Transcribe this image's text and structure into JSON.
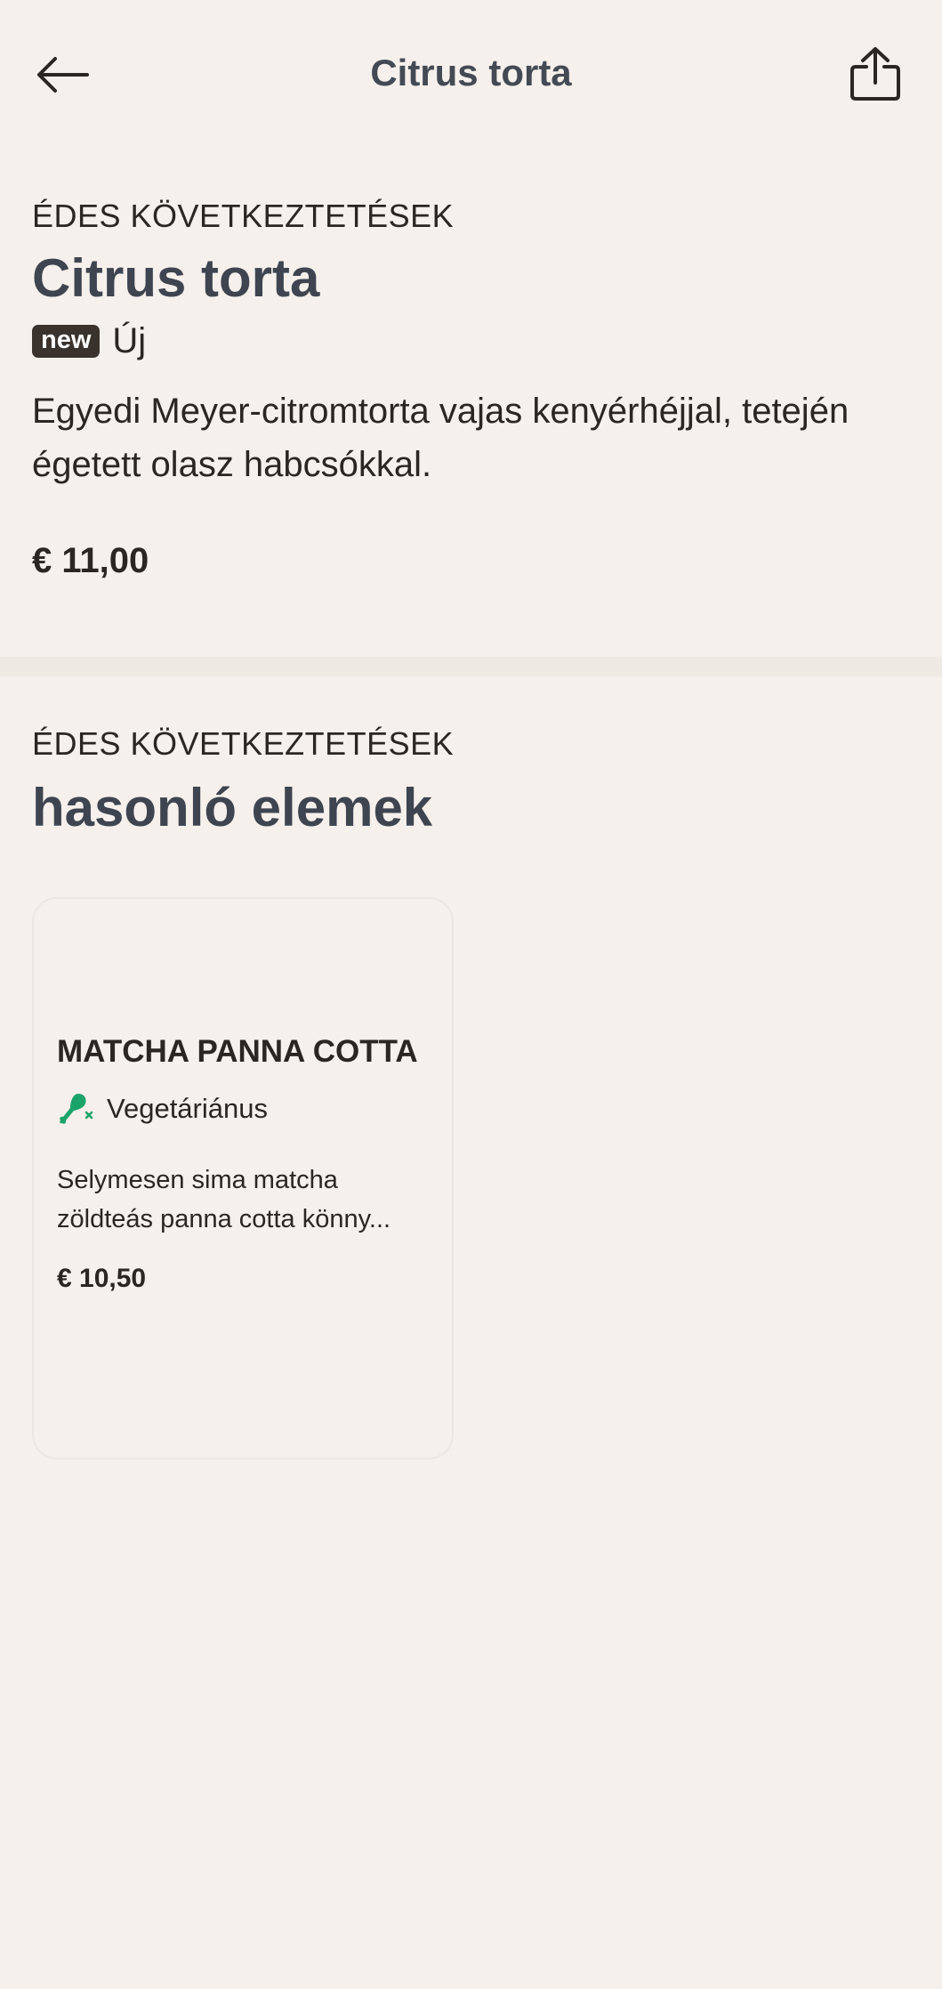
{
  "header": {
    "title": "Citrus torta",
    "back_icon": "arrow-left-icon",
    "share_icon": "share-icon"
  },
  "product": {
    "category": "ÉDES KÖVETKEZTETÉSEK",
    "title": "Citrus torta",
    "badge": "new",
    "badge_label": "Új",
    "description": "Egyedi Meyer-citromtorta vajas kenyérhéjjal, tetején égetett olasz habcsókkal.",
    "price": "€ 11,00"
  },
  "similar": {
    "category": "ÉDES KÖVETKEZTETÉSEK",
    "title": "hasonló elemek",
    "items": [
      {
        "name": "MATCHA PANNA COTTA",
        "diet_icon": "no-meat-icon",
        "diet_label": "Vegetáriánus",
        "description": "Selymesen sima matcha zöldteás panna cotta könny...",
        "price": "€ 10,50"
      }
    ]
  },
  "colors": {
    "background": "#f6f0ec",
    "title": "#3e4550",
    "badge": "#3a332d",
    "vegetarian": "#1aa46b"
  }
}
